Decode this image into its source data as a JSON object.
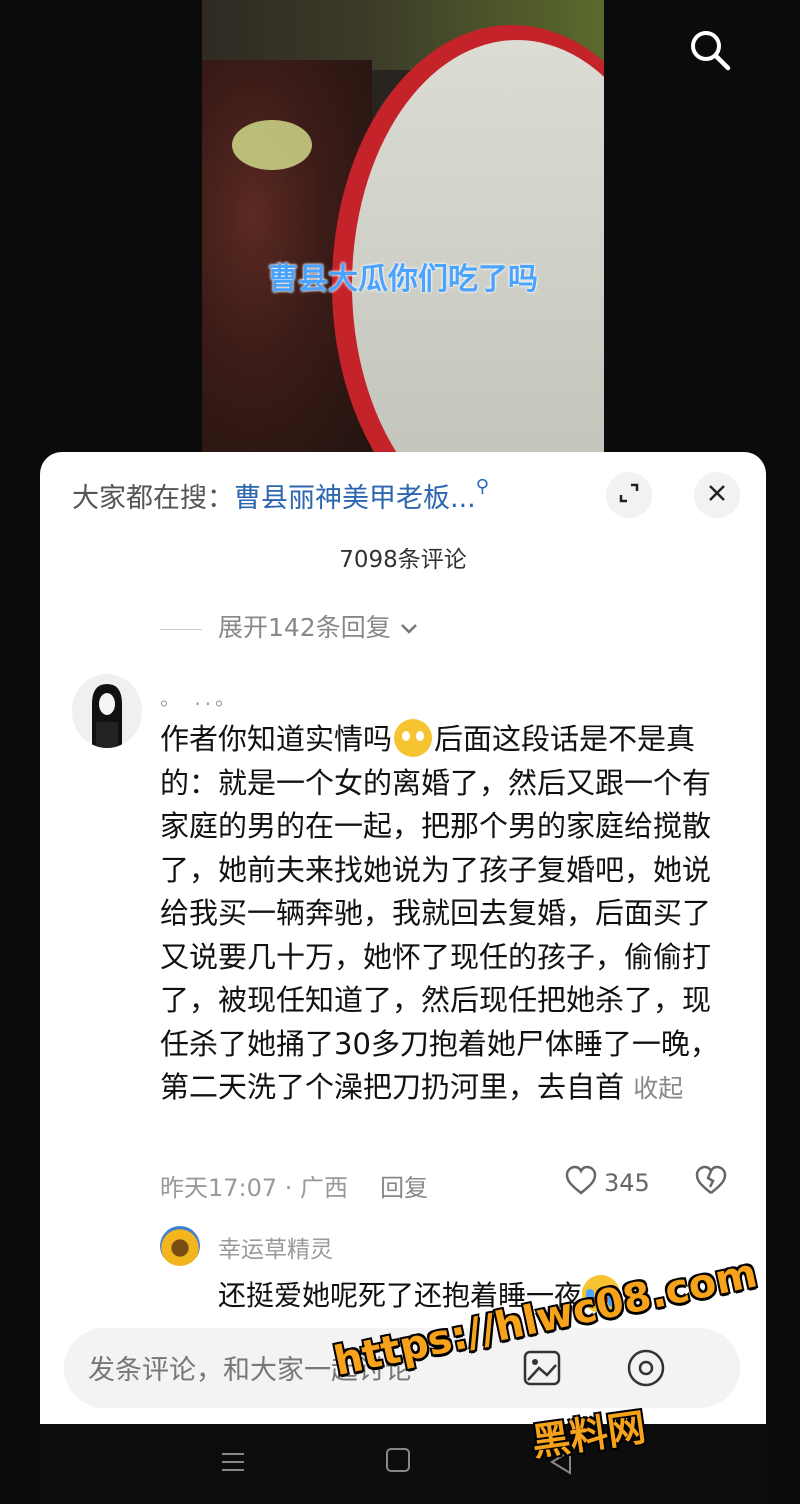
{
  "video": {
    "caption": "曹县大瓜你们吃了吗"
  },
  "top_bar": {
    "search_icon": "search-icon"
  },
  "panel": {
    "hot_search_prefix": "大家都在搜：",
    "hot_search_term": "曹县丽神美甲老板...",
    "expand_icon": "fullscreen-icon",
    "close_icon": "close-icon",
    "comment_count": "7098条评论",
    "expand_replies": "展开142条回复"
  },
  "comment": {
    "username": "。 ..。",
    "text_part1": "作者你知道实情吗",
    "emoji": "shy-face-emoji",
    "text_part2": "后面这段话是不是真的：就是一个女的离婚了，然后又跟一个有家庭的男的在一起，把那个男的家庭给搅散了，她前夫来找她说为了孩子复婚吧，她说给我买一辆奔驰，我就回去复婚，后面买了又说要几十万，她怀了现任的孩子，偷偷打了，被现任知道了，然后现任把她杀了，现任杀了她捅了30多刀抱着她尸体睡了一晚，第二天洗了个澡把刀扔河里，去自首",
    "collapse_label": "收起",
    "time_location": "昨天17:07 · 广西",
    "reply_label": "回复",
    "like_count": "345"
  },
  "sub_reply": {
    "username": "幸运草精灵",
    "text": "还挺爱她呢死了还抱着睡一夜",
    "emoji": "crying-face-emoji"
  },
  "input": {
    "placeholder": "发条评论，和大家一起讨论"
  },
  "watermark": {
    "url": "https://hlwc08.com",
    "name": "黑料网"
  },
  "colors": {
    "accent_blue": "#2c66b0",
    "caption_blue": "#4aa3ff",
    "watermark_orange": "#f7a21b"
  }
}
